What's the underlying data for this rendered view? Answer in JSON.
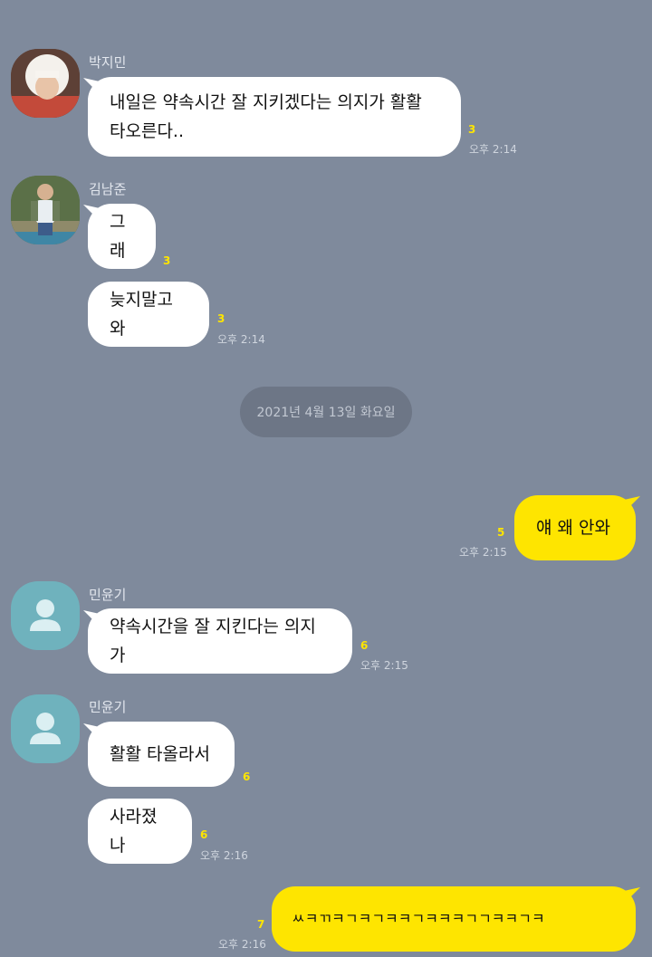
{
  "colors": {
    "background": "#7f8a9c",
    "bubble_other": "#ffffff",
    "bubble_me": "#fee500",
    "unread": "#fee500",
    "default_avatar": "#6fb2bd"
  },
  "messages": [
    {
      "sender": "박지민",
      "lines": [
        "내일은 약속시간 잘 지키겠다는 의지가 활활",
        "타오른다.."
      ],
      "unread": "3",
      "time": "오후 2:14"
    },
    {
      "sender": "김남준",
      "text": "그래",
      "unread": "3"
    },
    {
      "text": "늦지말고 와",
      "unread": "3",
      "time": "오후 2:14"
    },
    {
      "text": "얘 왜 안와",
      "unread": "5",
      "time": "오후 2:15"
    },
    {
      "sender": "민윤기",
      "text": "약속시간을 잘 지킨다는 의지가",
      "unread": "6",
      "time": "오후 2:15"
    },
    {
      "sender": "민윤기",
      "text": "활활 타올라서",
      "unread": "6"
    },
    {
      "text": "사라졌나",
      "unread": "6",
      "time": "오후 2:16"
    },
    {
      "text": "ㅆㅋㄲㅋㄱㅋㄱㅋㅋㄱㅋㅋㅋㄱㄱㅋㅋㄱㅋ",
      "unread": "7",
      "time": "오후 2:16"
    }
  ],
  "date_divider": "2021년 4월 13일 화요일",
  "icons": {
    "jimin_avatar": "profile-photo",
    "namjoon_avatar": "profile-photo",
    "yoongi_avatar": "default-person-icon"
  }
}
